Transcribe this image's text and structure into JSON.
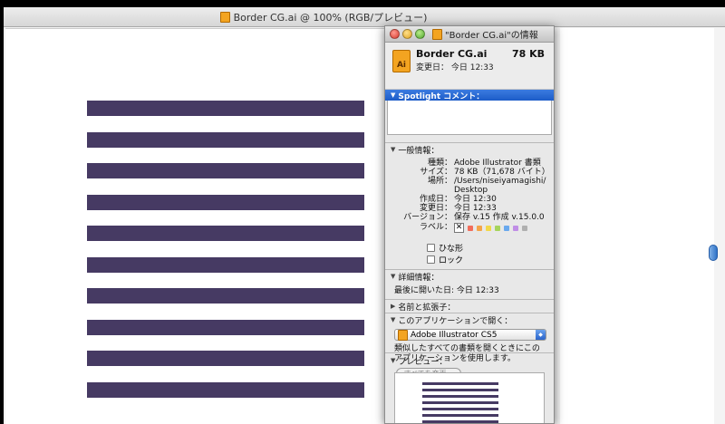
{
  "document": {
    "title": "Border CG.ai @ 100% (RGB/プレビュー)",
    "stripe_color": "#463a63",
    "stripe_count": 10
  },
  "info": {
    "window_title": "\"Border CG.ai\"の情報",
    "file_name": "Border CG.ai",
    "file_size": "78 KB",
    "modified_short": "変更日： 今日 12:33",
    "spotlight_label": "Spotlight コメント：",
    "general_label": "一般情報：",
    "general": [
      {
        "k": "種類：",
        "v": "Adobe Illustrator 書類"
      },
      {
        "k": "サイズ：",
        "v": "78 KB（71,678 バイト）"
      },
      {
        "k": "場所：",
        "v": "/Users/niseiyamagishi/"
      },
      {
        "k": "",
        "v": "Desktop"
      },
      {
        "k": "作成日：",
        "v": "今日 12:30"
      },
      {
        "k": "変更日：",
        "v": "今日 12:33"
      },
      {
        "k": "バージョン：",
        "v": "保存 v.15 作成 v.15.0.0"
      }
    ],
    "label_key": "ラベル：",
    "label_colors": [
      "#f26d5b",
      "#f4a54a",
      "#f2d84a",
      "#a6d45c",
      "#6aa9ee",
      "#c08ee6",
      "#b0b0b0"
    ],
    "stationery_label": "ひな形",
    "locked_label": "ロック",
    "more_info_label": "詳細情報：",
    "last_opened": "最後に開いた日: 今日 12:33",
    "name_ext_label": "名前と拡張子：",
    "open_with_label": "このアプリケーションで開く：",
    "open_with_app": "Adobe Illustrator CS5",
    "open_with_desc": "類似したすべての書類を開くときにこのアプリケーションを使用します。",
    "change_all_button": "すべてを変更…",
    "preview_label": "プレビュー："
  }
}
